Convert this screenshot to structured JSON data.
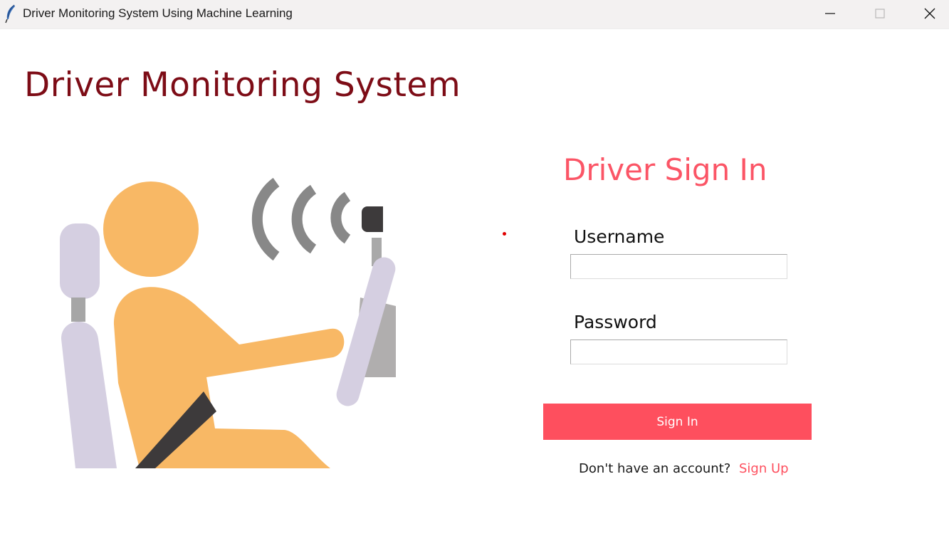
{
  "window": {
    "title": "Driver Monitoring System Using Machine Learning",
    "app_icon": "feather-icon",
    "controls": {
      "minimize_icon": "minimize-icon",
      "maximize_icon": "maximize-icon",
      "close_icon": "close-icon"
    }
  },
  "main": {
    "heading": "Driver Monitoring System",
    "illustration_icon": "driver-seatbelt-illustration"
  },
  "signin": {
    "title": "Driver Sign In",
    "username_label": "Username",
    "username_value": "",
    "password_label": "Password",
    "password_value": "",
    "button_label": "Sign In",
    "footer_prompt": "Don't have an account?",
    "signup_link": "Sign Up"
  },
  "colors": {
    "heading": "#7d0c16",
    "accent": "#fe4f5e",
    "title_accent": "#fb5566",
    "skin": "#f8b865",
    "seat": "#d5cfe1",
    "signal": "#888888"
  }
}
